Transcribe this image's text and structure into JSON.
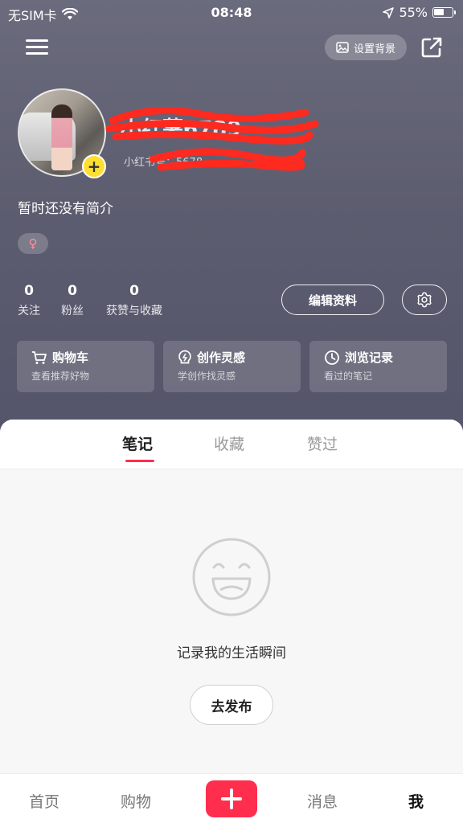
{
  "status_bar": {
    "carrier": "无SIM卡",
    "time": "08:48",
    "battery": "55%",
    "battery_level": 0.55
  },
  "header": {
    "set_background_label": "设置背景"
  },
  "profile": {
    "username": "小红薯6789",
    "id_label": "小红书号：",
    "id_value": "5678",
    "bio": "暂时还没有简介",
    "gender_symbol": "♀"
  },
  "stats": [
    {
      "value": "0",
      "label": "关注"
    },
    {
      "value": "0",
      "label": "粉丝"
    },
    {
      "value": "0",
      "label": "获赞与收藏"
    }
  ],
  "actions": {
    "edit_profile": "编辑资料"
  },
  "cards": [
    {
      "title": "购物车",
      "subtitle": "查看推荐好物",
      "icon": "cart-icon"
    },
    {
      "title": "创作灵感",
      "subtitle": "学创作找灵感",
      "icon": "bulb-icon"
    },
    {
      "title": "浏览记录",
      "subtitle": "看过的笔记",
      "icon": "clock-icon"
    }
  ],
  "tabs": [
    {
      "label": "笔记",
      "active": true
    },
    {
      "label": "收藏",
      "active": false
    },
    {
      "label": "赞过",
      "active": false
    }
  ],
  "empty_state": {
    "message": "记录我的生活瞬间",
    "button": "去发布"
  },
  "bottom_nav": [
    {
      "label": "首页",
      "active": false
    },
    {
      "label": "购物",
      "active": false
    },
    {
      "label": "消息",
      "active": false
    },
    {
      "label": "我",
      "active": true
    }
  ],
  "colors": {
    "accent": "#ff2e4d",
    "avatar_badge": "#ffde32",
    "hero_bg": "#5d5d70"
  }
}
